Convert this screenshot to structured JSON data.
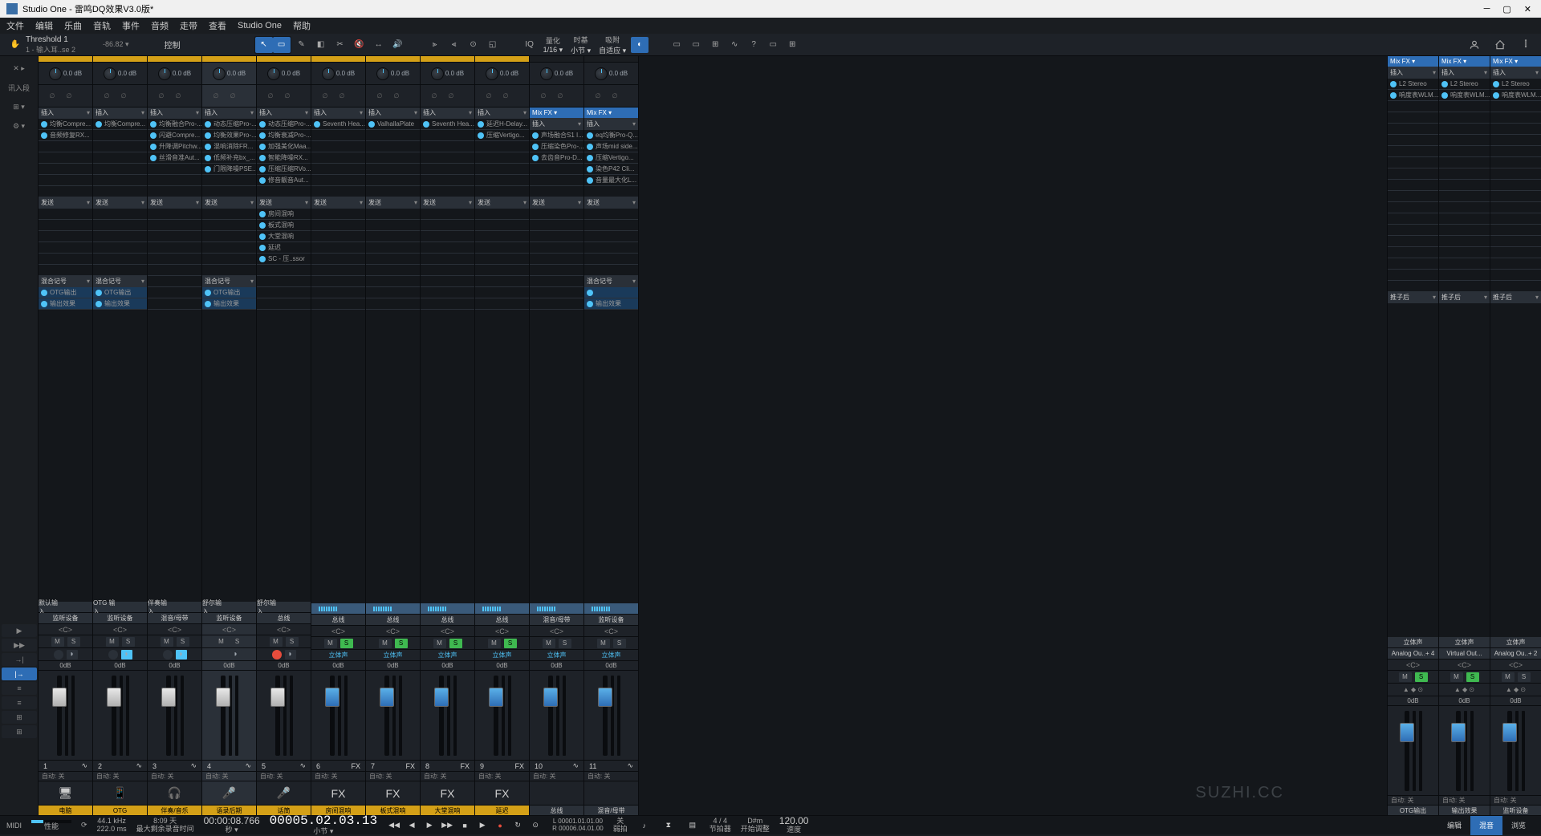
{
  "window": {
    "title": "Studio One - 雷鸣DQ效果V3.0版*"
  },
  "menu": [
    "文件",
    "编辑",
    "乐曲",
    "音轨",
    "事件",
    "音频",
    "走带",
    "查看",
    "Studio One",
    "帮助"
  ],
  "toolbar": {
    "info": {
      "title": "Threshold 1",
      "sub": "1 - 输入耳..se 2",
      "val": "-86.82 ▾",
      "ctrl": "控制"
    },
    "quant": {
      "lbl": "量化",
      "val": "1/16 ▾"
    },
    "timebase": {
      "lbl": "时基",
      "val": "小节 ▾"
    },
    "snap": {
      "lbl": "吸附",
      "val": "自适应 ▾"
    }
  },
  "channels": [
    {
      "num": "1",
      "name": "电脑",
      "in": "默认输入",
      "out": "监听设备",
      "icon": "🖥",
      "y": true,
      "db": "0.0 dB",
      "inserts": [
        "均衡Compre..."
      ],
      "misc": [
        "音频修复RX..."
      ],
      "sends": [],
      "mixlabel": "混合记号",
      "out2": "OTG输出",
      "out3": "输出效果",
      "dbf": "0dB",
      "auto": "自动: 关",
      "rec": false,
      "mon": false,
      "solo": false
    },
    {
      "num": "2",
      "name": "OTG",
      "in": "OTG 输入",
      "out": "监听设备",
      "icon": "📱",
      "y": true,
      "db": "0.0 dB",
      "inserts": [
        "均衡Compre..."
      ],
      "misc": [],
      "sends": [],
      "mixlabel": "混合记号",
      "out2": "OTG输出",
      "out3": "输出效果",
      "dbf": "0dB",
      "auto": "自动: 关",
      "rec": false,
      "mon": true,
      "solo": false
    },
    {
      "num": "3",
      "name": "伴奏/音乐",
      "in": "伴奏输入",
      "out": "混音/母带",
      "icon": "🎧",
      "y": true,
      "db": "0.0 dB",
      "inserts": [
        "均衡融合Pro-...",
        "闪避Compre...",
        "升降调Pitchw...",
        "丝滑音准Aut..."
      ],
      "misc": [],
      "sends": [],
      "mixlabel": "",
      "out2": "",
      "out3": "",
      "dbf": "0dB",
      "auto": "自动: 关",
      "rec": false,
      "mon": true,
      "solo": false
    },
    {
      "num": "4",
      "name": "语录后期",
      "in": "舒尔输入",
      "out": "监听设备",
      "icon": "🎤",
      "y": true,
      "sel": true,
      "db": "0.0 dB",
      "inserts": [
        "动态压缩Pro-...",
        "均衡效果Pro-...",
        "混响消除FR...",
        "低频补充bx_...",
        "门限降噪PSE..."
      ],
      "misc": [],
      "sends": [],
      "mixlabel": "混合记号",
      "out2": "OTG输出",
      "out3": "输出效果",
      "dbf": "0dB",
      "auto": "自动: 关",
      "rec": true,
      "mon": false,
      "solo": false
    },
    {
      "num": "5",
      "name": "话筒",
      "in": "舒尔输入",
      "out": "总线",
      "icon": "🎤",
      "y": true,
      "db": "0.0 dB",
      "inserts": [
        "动态压缩Pro-...",
        "均衡衰减Pro-...",
        "加强美化Maa...",
        "智能降噪RX...",
        "压缩压缩RVo...",
        "修音靓音Aut..."
      ],
      "misc": [],
      "sends": [
        "房间混响",
        "板式混响",
        "大堂混响",
        "延迟",
        "SC - 压..ssor"
      ],
      "mixlabel": "",
      "out2": "",
      "out3": "",
      "dbf": "0dB",
      "auto": "自动: 关",
      "rec": false,
      "mon": false,
      "solo": false,
      "fx": false,
      "recOn": true
    },
    {
      "num": "6",
      "name": "房间混响",
      "in": "",
      "out": "总线",
      "icon": "FX",
      "y": true,
      "db": "0.0 dB",
      "inserts": [
        "Seventh Hea..."
      ],
      "misc": [],
      "sends": [],
      "dbf": "0dB",
      "auto": "自动: 关",
      "fx": true,
      "stereo": "立体声",
      "solo": true
    },
    {
      "num": "7",
      "name": "板式混响",
      "in": "",
      "out": "总线",
      "icon": "FX",
      "y": true,
      "db": "0.0 dB",
      "inserts": [
        "ValhallaPlate"
      ],
      "misc": [],
      "sends": [],
      "dbf": "0dB",
      "auto": "自动: 关",
      "fx": true,
      "stereo": "立体声",
      "solo": true
    },
    {
      "num": "8",
      "name": "大堂混响",
      "in": "",
      "out": "总线",
      "icon": "FX",
      "y": true,
      "db": "0.0 dB",
      "inserts": [
        "Seventh Hea..."
      ],
      "misc": [],
      "sends": [],
      "dbf": "0dB",
      "auto": "自动: 关",
      "fx": true,
      "stereo": "立体声",
      "solo": true
    },
    {
      "num": "9",
      "name": "延迟",
      "in": "",
      "out": "总线",
      "icon": "FX",
      "y": true,
      "db": "0.0 dB",
      "inserts": [
        "延迟H-Delay...",
        "压缩Vertigo..."
      ],
      "misc": [],
      "sends": [],
      "dbf": "0dB",
      "auto": "自动: 关",
      "fx": true,
      "stereo": "立体声",
      "solo": true
    },
    {
      "num": "10",
      "name": "总线",
      "in": "",
      "out": "混音/母带",
      "icon": "",
      "y": false,
      "db": "0.0 dB",
      "mixfx": "Mix FX",
      "inserts": [
        "声场融合S1 I...",
        "压缩染色Pro-...",
        "去齿音Pro-D..."
      ],
      "misc": [],
      "sends": [],
      "dbf": "0dB",
      "auto": "自动: 关",
      "stereo": "立体声"
    },
    {
      "num": "11",
      "name": "混音/母带",
      "in": "",
      "out": "监听设备",
      "icon": "",
      "y": false,
      "db": "0.0 dB",
      "mixfx": "Mix FX",
      "inserts": [
        "eq均衡Pro-Q...",
        "声场mid side...",
        "压缩Vertigo...",
        "染色P42 Cli...",
        "音量最大化L..."
      ],
      "misc": [],
      "sends": [],
      "mixlabel": "混合记号",
      "out2": "",
      "out3": "输出效果",
      "dbf": "0dB",
      "auto": "自动: 关",
      "stereo": "立体声"
    }
  ],
  "rchannels": [
    {
      "mixfx": "Mix FX",
      "ins": "插入",
      "fx": [
        "L2 Stereo",
        "响度表WLM..."
      ],
      "post": "推子后",
      "io": "立体声",
      "out": "Analog Ou..+ 4",
      "name": "OTG输出",
      "db": "0dB",
      "auto": "自动: 关",
      "solo": true
    },
    {
      "mixfx": "Mix FX",
      "ins": "插入",
      "fx": [
        "L2 Stereo",
        "响度表WLM..."
      ],
      "post": "推子后",
      "io": "立体声",
      "out": "Virtual Out...",
      "name": "输出效果",
      "db": "0dB",
      "auto": "自动: 关",
      "solo": true
    },
    {
      "mixfx": "Mix FX",
      "ins": "插入",
      "fx": [
        "L2 Stereo",
        "响度表WLM..."
      ],
      "post": "推子后",
      "io": "立体声",
      "out": "Analog Ou..+ 2",
      "name": "监听设备",
      "db": "0dB",
      "auto": "自动: 关"
    }
  ],
  "leftctrl": [
    "▶",
    "▶▶",
    "→|",
    "|→",
    "≡",
    "≡",
    "⊞",
    "⊞"
  ],
  "status": {
    "midi": "MIDI",
    "perf": "性能",
    "rate": "44.1 kHz",
    "lat": "222.0 ms",
    "time": "8:09 天",
    "rem": "最大剩余录音时间",
    "tc1": "00:00:08.766",
    "tc1u": "秒 ▾",
    "tc2": "00005.02.03.13",
    "tc2u": "小节 ▾",
    "loop": {
      "l": "L",
      "r": "R",
      "s": "00001.01.01.00",
      "e": "00006.04.01.00"
    },
    "met": "关",
    "met2": "弱拍",
    "sig": "4 / 4",
    "sig2": "节拍器",
    "key": "D#m",
    "key2": "开始调整",
    "tempo": "120.00",
    "tempo2": "速度",
    "tabs": [
      "编辑",
      "混音",
      "浏览"
    ]
  },
  "watermark": "SUZHI.CC",
  "hdr": {
    "insert": "插入",
    "send": "发送"
  }
}
